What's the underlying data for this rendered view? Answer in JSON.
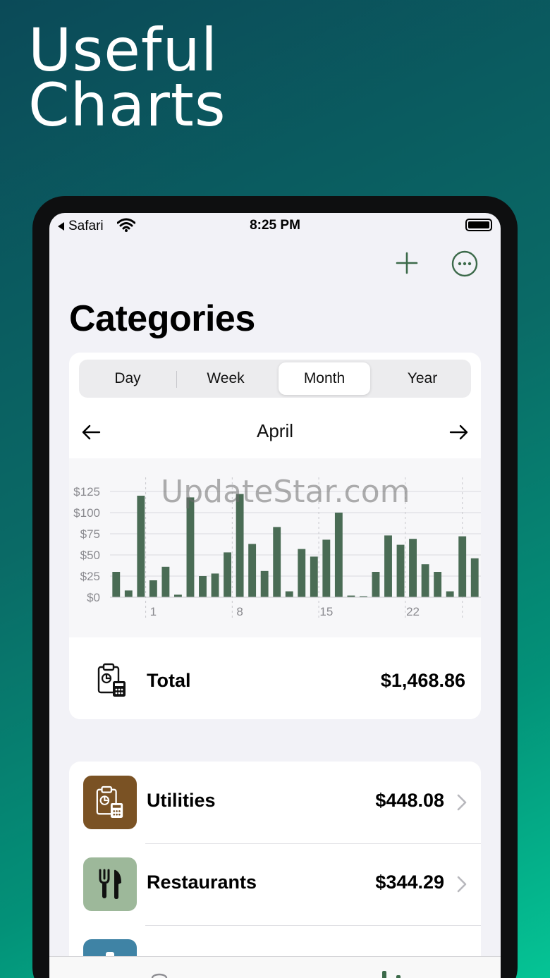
{
  "promo": {
    "line1": "Useful",
    "line2": "Charts"
  },
  "status": {
    "back_app": "Safari",
    "time": "8:25 PM"
  },
  "page": {
    "title": "Categories"
  },
  "segment": {
    "options": [
      "Day",
      "Week",
      "Month",
      "Year"
    ],
    "selected": "Month"
  },
  "period": {
    "label": "April"
  },
  "chart_data": {
    "type": "bar",
    "x": [
      29,
      30,
      31,
      1,
      2,
      3,
      4,
      5,
      6,
      7,
      8,
      9,
      10,
      11,
      12,
      13,
      14,
      15,
      16,
      17,
      18,
      19,
      20,
      21,
      22,
      23,
      24,
      25,
      26,
      27
    ],
    "values": [
      30,
      8,
      120,
      20,
      36,
      3,
      118,
      25,
      28,
      53,
      122,
      63,
      31,
      83,
      7,
      57,
      48,
      68,
      100,
      2,
      1,
      30,
      73,
      62,
      69,
      39,
      30,
      7,
      72,
      46
    ],
    "xticks": [
      1,
      8,
      15,
      22
    ],
    "ylim": [
      0,
      125
    ],
    "yticks": [
      0,
      25,
      50,
      75,
      100,
      125
    ],
    "ytick_labels": [
      "$0",
      "$25",
      "$50",
      "$75",
      "$100",
      "$125"
    ],
    "bar_color": "#4a6c55",
    "grid": true
  },
  "watermark": "UpdateStar.com",
  "total": {
    "label": "Total",
    "value": "$1,468.86"
  },
  "categories": [
    {
      "name": "Utilities",
      "amount": "$448.08",
      "icon": "clipboard-calculator-icon",
      "color": "#7a5224"
    },
    {
      "name": "Restaurants",
      "amount": "$344.29",
      "icon": "fork-knife-icon",
      "color": "#9db89a"
    },
    {
      "name": "",
      "amount": "",
      "icon": "partial-icon",
      "color": "#3f83a5"
    }
  ],
  "colors": {
    "accent": "#3c6a4a"
  }
}
